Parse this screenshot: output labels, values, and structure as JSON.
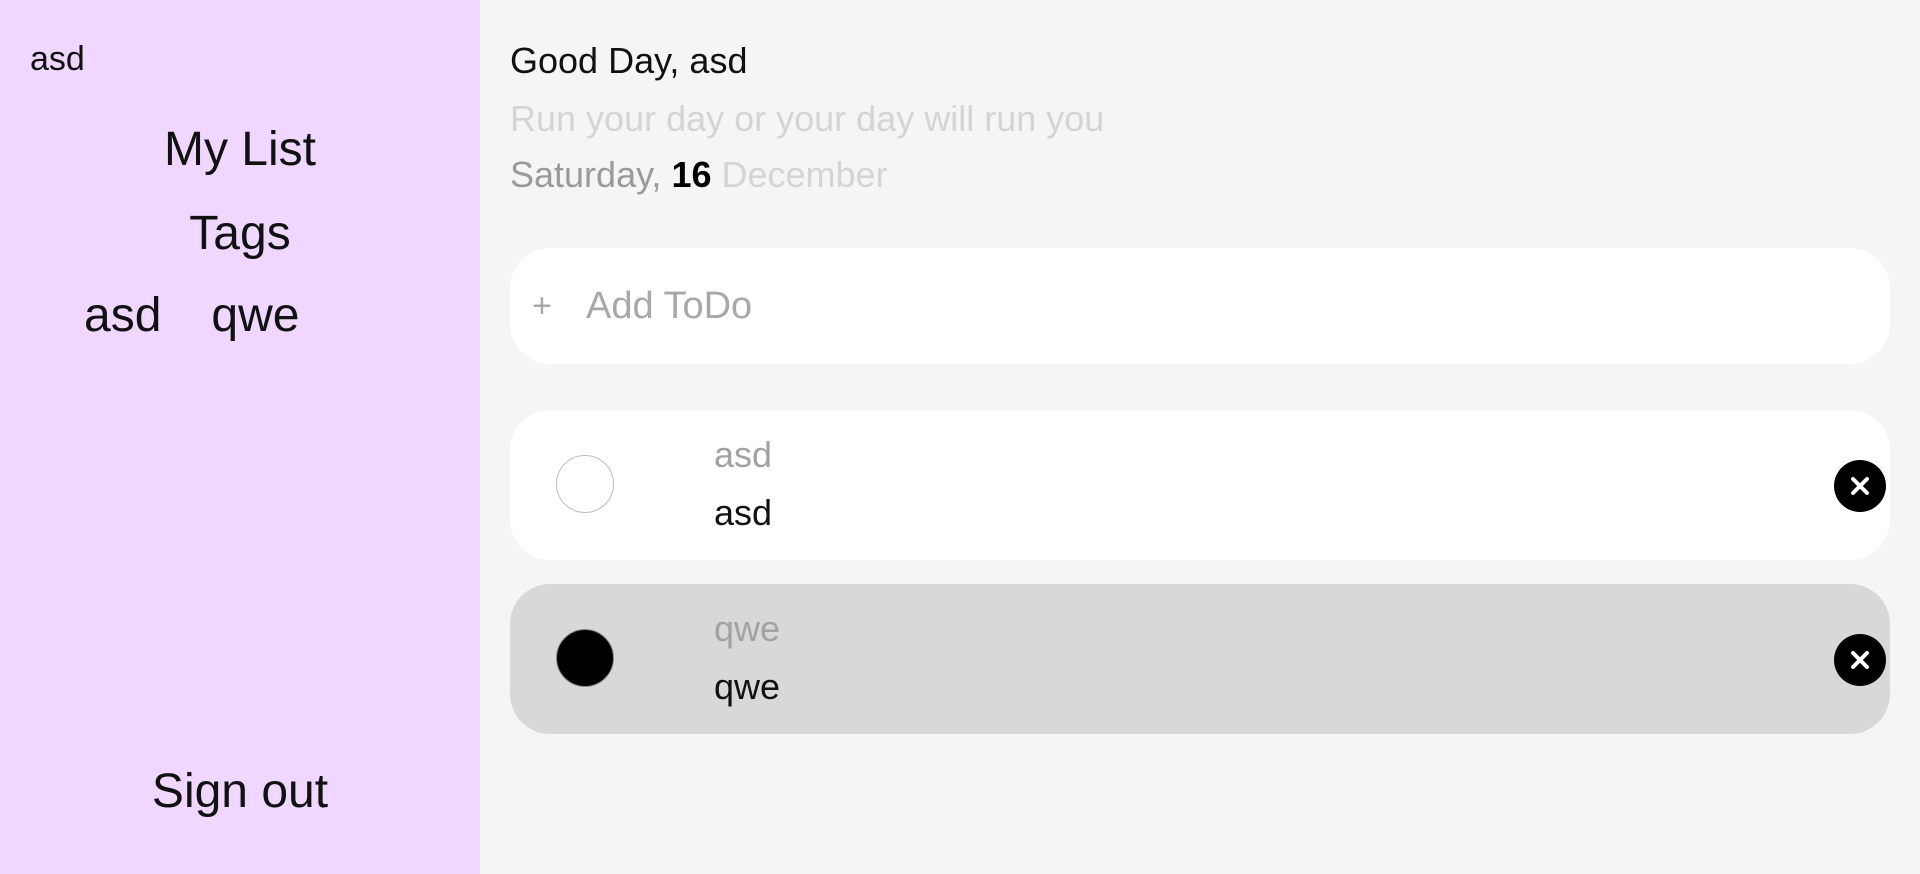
{
  "sidebar": {
    "username": "asd",
    "nav": {
      "my_list": "My List",
      "tags": "Tags"
    },
    "tags": [
      "asd",
      "qwe"
    ],
    "sign_out": "Sign out",
    "background_color": "#efd7ff"
  },
  "header": {
    "greeting": "Good Day, asd",
    "motto": "Run your day or your day will run you",
    "date": {
      "weekday": "Saturday,",
      "day": "16",
      "month": "December"
    }
  },
  "add_todo": {
    "icon": "plus-icon",
    "plus_symbol": "+",
    "placeholder": "Add ToDo",
    "value": ""
  },
  "todos": [
    {
      "title": "asd",
      "description": "asd",
      "completed": false,
      "delete_icon": "close-icon"
    },
    {
      "title": "qwe",
      "description": "qwe",
      "completed": true,
      "delete_icon": "close-icon"
    }
  ],
  "colors": {
    "completed_row": "#d8d8d8",
    "active_row": "#ffffff",
    "accent": "#000000"
  }
}
